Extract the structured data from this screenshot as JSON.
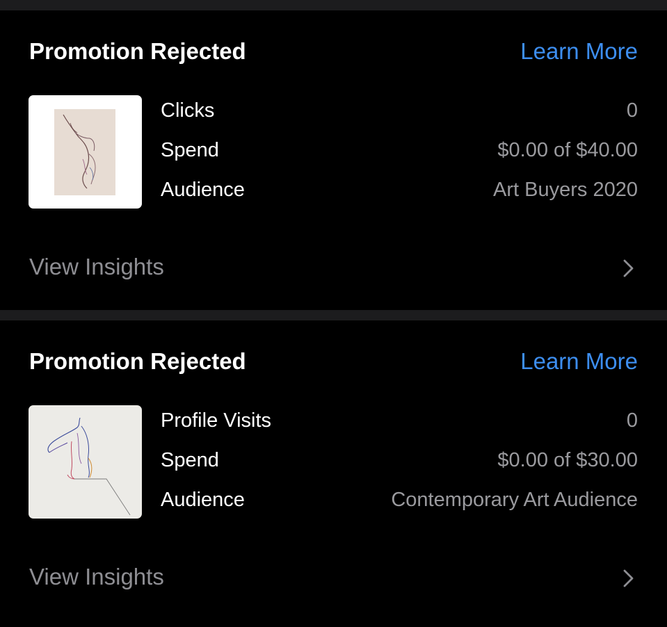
{
  "promotions": [
    {
      "title": "Promotion Rejected",
      "learn_more": "Learn More",
      "thumbnail": "figure-sketch-on-beige-paper",
      "stats": [
        {
          "label": "Clicks",
          "value": "0"
        },
        {
          "label": "Spend",
          "value": "$0.00 of $40.00"
        },
        {
          "label": "Audience",
          "value": "Art Buyers 2020"
        }
      ],
      "insights_label": "View Insights"
    },
    {
      "title": "Promotion Rejected",
      "learn_more": "Learn More",
      "thumbnail": "colored-line-figure-drawing",
      "stats": [
        {
          "label": "Profile Visits",
          "value": "0"
        },
        {
          "label": "Spend",
          "value": "$0.00 of $30.00"
        },
        {
          "label": "Audience",
          "value": "Contemporary Art Audience"
        }
      ],
      "insights_label": "View Insights"
    }
  ],
  "colors": {
    "background": "#000000",
    "divider": "#1c1c1e",
    "link": "#3d8ef0",
    "secondary_text": "#9a9a9e"
  }
}
